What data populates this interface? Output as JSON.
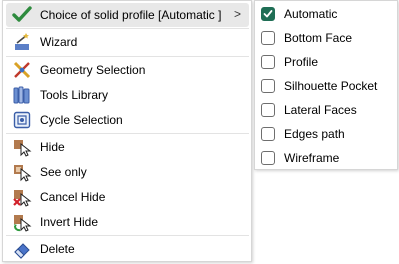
{
  "menu": {
    "items": [
      {
        "label": "Choice of solid profile  [Automatic ]",
        "icon": "green-checkmark-icon",
        "has_submenu": true,
        "highlighted": true
      },
      {
        "label": "Wizard",
        "icon": "wizard-wand-icon"
      },
      {
        "label": "Geometry Selection",
        "icon": "geometry-selection-icon"
      },
      {
        "label": "Tools Library",
        "icon": "tools-library-icon"
      },
      {
        "label": "Cycle Selection",
        "icon": "cycle-selection-icon"
      },
      {
        "label": "Hide",
        "icon": "hide-icon"
      },
      {
        "label": "See only",
        "icon": "see-only-icon"
      },
      {
        "label": "Cancel Hide",
        "icon": "cancel-hide-icon"
      },
      {
        "label": "Invert Hide",
        "icon": "invert-hide-icon"
      },
      {
        "label": "Delete",
        "icon": "eraser-icon"
      }
    ],
    "submenu_arrow": ">"
  },
  "submenu": {
    "options": [
      {
        "label": "Automatic",
        "checked": true
      },
      {
        "label": "Bottom Face",
        "checked": false
      },
      {
        "label": "Profile",
        "checked": false
      },
      {
        "label": "Silhouette Pocket",
        "checked": false
      },
      {
        "label": "Lateral Faces",
        "checked": false
      },
      {
        "label": "Edges path",
        "checked": false
      },
      {
        "label": "Wireframe",
        "checked": false
      }
    ]
  },
  "colors": {
    "check_accent": "#1f6e55",
    "highlight": "#e8e8e8",
    "separator": "#e3e3e3"
  }
}
